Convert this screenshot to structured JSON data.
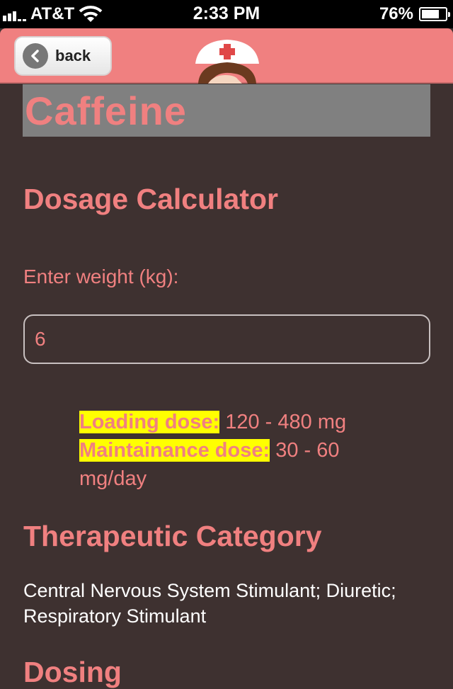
{
  "status_bar": {
    "carrier": "AT&T",
    "time": "2:33 PM",
    "battery": "76%",
    "battery_level": 0.76
  },
  "nav": {
    "back_label": "back"
  },
  "page": {
    "title": "Caffeine",
    "calculator_heading": "Dosage Calculator",
    "weight_label": "Enter weight (kg):",
    "weight_value": "6",
    "loading_dose_label": "Loading dose:",
    "loading_dose_value": "120 - 480 mg",
    "maintenance_dose_label": "Maintainance dose:",
    "maintenance_dose_value": "30 - 60 mg/day",
    "category_heading": "Therapeutic Category",
    "category_text": "Central Nervous System Stimulant; Diuretic; Respiratory Stimulant",
    "dosing_heading": "Dosing"
  },
  "colors": {
    "accent": "#f08080",
    "background": "#3e3130",
    "highlight": "#ffff00",
    "title_box": "#808080"
  }
}
